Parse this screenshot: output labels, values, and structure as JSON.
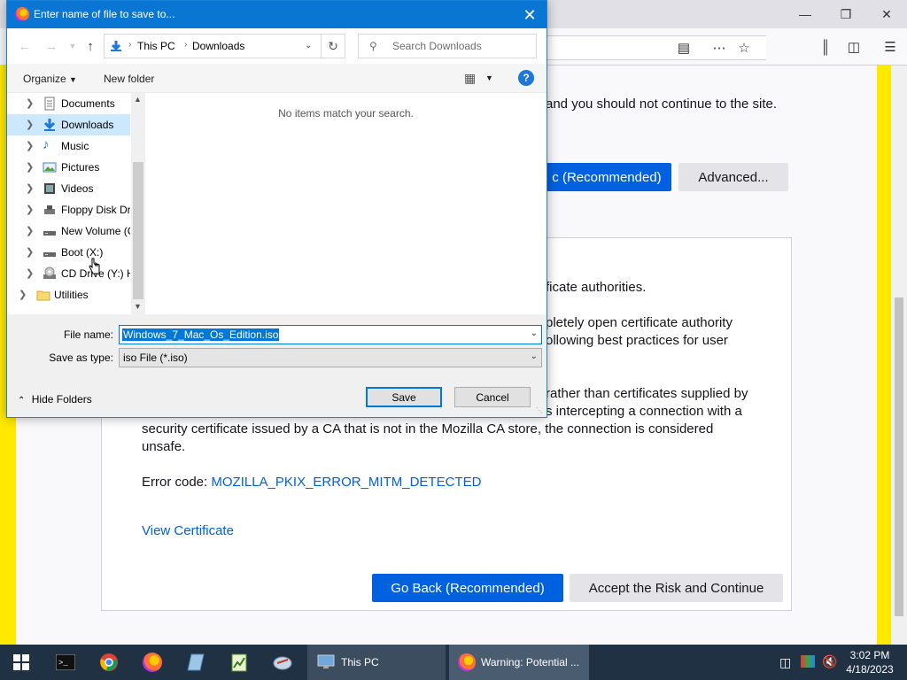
{
  "browser": {
    "page": {
      "partial_line1": "and you should not continue to the site.",
      "partial_recommended_btn": "c (Recommended)",
      "advanced_btn": "Advanced...",
      "partial_line2": "ficate authorities.",
      "partial_line3a": "pletely open certificate authority",
      "partial_line3b": "ollowing best practices for user",
      "partial_line4a": "rather than certificates supplied by",
      "partial_line4b": "s intercepting a connection with a",
      "line5": "security certificate issued by a CA that is not in the Mozilla CA store, the connection is considered",
      "line6": "unsafe.",
      "error_code_label": "Error code:",
      "error_code": "MOZILLA_PKIX_ERROR_MITM_DETECTED",
      "view_certificate": "View Certificate",
      "go_back_btn": "Go Back (Recommended)",
      "accept_btn": "Accept the Risk and Continue"
    }
  },
  "dialog": {
    "title": "Enter name of file to save to...",
    "breadcrumb": [
      "This PC",
      "Downloads"
    ],
    "search_placeholder": "Search Downloads",
    "organize": "Organize",
    "new_folder": "New folder",
    "nav_items": [
      {
        "label": "Documents",
        "icon": "document-icon"
      },
      {
        "label": "Downloads",
        "icon": "download-icon"
      },
      {
        "label": "Music",
        "icon": "music-icon"
      },
      {
        "label": "Pictures",
        "icon": "pictures-icon"
      },
      {
        "label": "Videos",
        "icon": "videos-icon"
      },
      {
        "label": "Floppy Disk Dri",
        "icon": "floppy-icon"
      },
      {
        "label": "New Volume (C",
        "icon": "drive-icon"
      },
      {
        "label": "Boot (X:)",
        "icon": "drive-icon"
      },
      {
        "label": "CD Drive (Y:) H",
        "icon": "cd-drive-icon"
      },
      {
        "label": "Utilities",
        "icon": "folder-icon"
      }
    ],
    "empty_message": "No items match your search.",
    "file_name_label": "File name:",
    "file_name_value": "Windows_7_Mac_Os_Edition.iso",
    "save_type_label": "Save as type:",
    "save_type_value": "iso File (*.iso)",
    "hide_folders": "Hide Folders",
    "save_btn": "Save",
    "cancel_btn": "Cancel"
  },
  "taskbar": {
    "task1": "This PC",
    "task2": "Warning: Potential ...",
    "time": "3:02 PM",
    "date": "4/18/2023"
  },
  "colors": {
    "accent_blue": "#0061e0",
    "warning_stripe": "#ffe900",
    "dialog_title_bar": "#0a76d4",
    "taskbar": "#1f3143"
  }
}
